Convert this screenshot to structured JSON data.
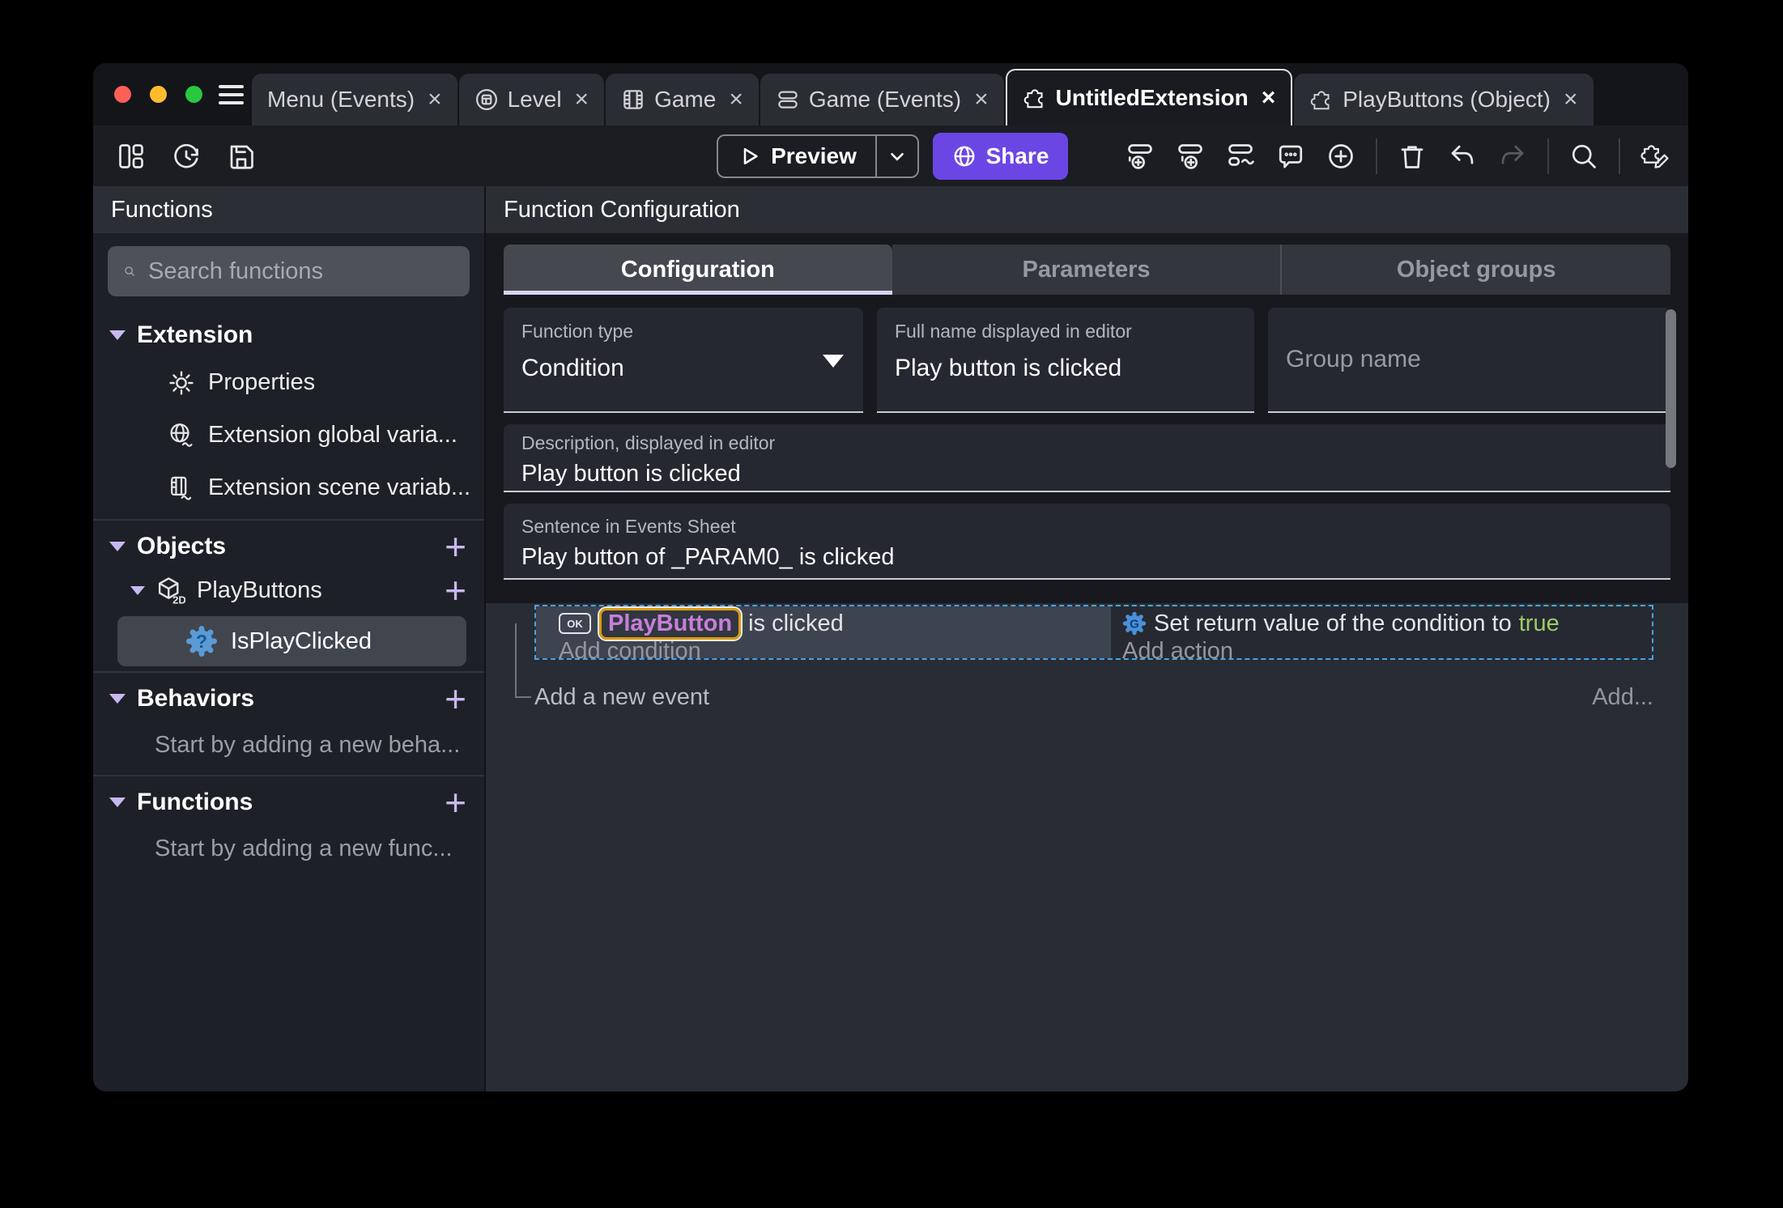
{
  "window": {
    "tabs": [
      {
        "label": "Menu (Events)"
      },
      {
        "label": "Level"
      },
      {
        "label": "Game"
      },
      {
        "label": "Game (Events)"
      },
      {
        "label": "UntitledExtension"
      },
      {
        "label": "PlayButtons (Object)"
      }
    ],
    "close_glyph": "×"
  },
  "toolbar": {
    "preview_label": "Preview",
    "share_label": "Share"
  },
  "sidebar": {
    "title": "Functions",
    "search_placeholder": "Search functions",
    "extension": {
      "label": "Extension",
      "items": [
        {
          "label": "Properties"
        },
        {
          "label": "Extension global varia..."
        },
        {
          "label": "Extension scene variab..."
        }
      ]
    },
    "objects": {
      "label": "Objects",
      "object_label": "PlayButtons",
      "function_label": "IsPlayClicked"
    },
    "behaviors": {
      "label": "Behaviors",
      "hint": "Start by adding a new beha..."
    },
    "functions": {
      "label": "Functions",
      "hint": "Start by adding a new func..."
    },
    "plus_glyph": "+"
  },
  "main": {
    "title": "Function Configuration",
    "tabs": [
      {
        "label": "Configuration"
      },
      {
        "label": "Parameters"
      },
      {
        "label": "Object groups"
      }
    ],
    "fields": {
      "function_type": {
        "label": "Function type",
        "value": "Condition"
      },
      "full_name": {
        "label": "Full name displayed in editor",
        "value": "Play button is clicked"
      },
      "group_name": {
        "placeholder": "Group name"
      },
      "description": {
        "label": "Description, displayed in editor",
        "value": "Play button is clicked"
      },
      "sentence": {
        "label": "Sentence in Events Sheet",
        "value": "Play button of _PARAM0_ is clicked"
      }
    },
    "events": {
      "condition": {
        "chip": "OK",
        "object": "PlayButton",
        "text": "is clicked",
        "add": "Add condition"
      },
      "action": {
        "text": "Set return value of the condition to",
        "value": "true",
        "add": "Add action"
      },
      "add_event": "Add a new event",
      "add_more": "Add..."
    }
  },
  "colors": {
    "share_purple": "#6b46e5",
    "object_name_purple": "#c77fd9",
    "badge_border_orange": "#dd9a0f",
    "true_green": "#9ccb65",
    "selection_blue": "#4aa3e0",
    "accent_lavender": "#c8b8f0"
  }
}
